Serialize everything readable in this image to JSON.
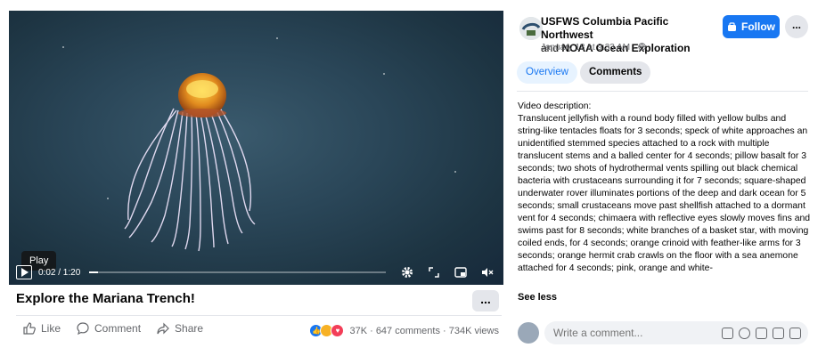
{
  "video": {
    "tooltip": "Play",
    "time": "0:02 / 1:20",
    "progress": 0.03,
    "title": "Explore the Mariana Trench!",
    "more_label": "...",
    "actions": {
      "like": "Like",
      "comment": "Comment",
      "share": "Share"
    },
    "stats": "37K · 647 comments · 734K views",
    "colors": {
      "like": "#1877f2",
      "haha": "#f7b125",
      "love": "#f33e58"
    }
  },
  "post": {
    "author_primary": "USFWS Columbia Pacific Northwest",
    "author_joiner": "and",
    "author_secondary": "NOAA Ocean Exploration",
    "timestamp": "January 18 at 9:33 AM · ",
    "follow_label": "Follow",
    "more_label": "...",
    "tabs": {
      "overview": "Overview",
      "comments": "Comments"
    },
    "description_heading": "Video description:",
    "description": "Translucent jellyfish with a round body filled with yellow bulbs and string-like tentacles floats for 3 seconds; speck of white approaches an unidentified stemmed species attached to a rock with multiple translucent stems and a balled center for 4 seconds; pillow basalt for 3 seconds; two shots of hydrothermal vents spilling out black chemical bacteria with crustaceans surrounding it for 7 seconds; square-shaped underwater rover illuminates portions of the deep and dark ocean for 5 seconds; small crustaceans move past shellfish attached to a dormant vent for 4 seconds; chimaera with reflective eyes slowly moves fins and swims past for 8 seconds; white branches of a basket star, with moving coiled ends, for 4 seconds; orange crinoid with feather-like arms for 3 seconds; orange hermit crab crawls on the floor with a sea anemone attached for 4 seconds; pink, orange and white-",
    "see_less": "See less",
    "comment_placeholder": "Write a comment...",
    "accent": "#1877f2"
  }
}
